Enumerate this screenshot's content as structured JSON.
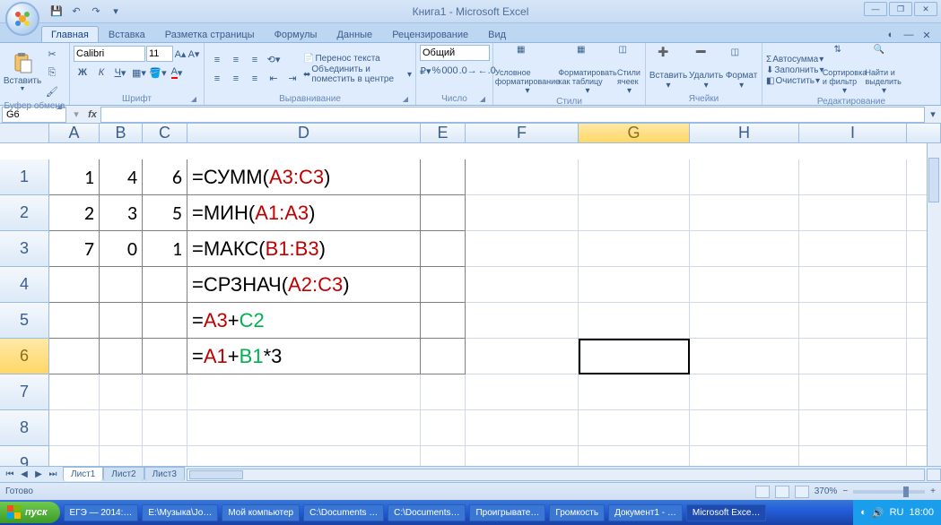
{
  "title": "Книга1 - Microsoft Excel",
  "tabs": [
    "Главная",
    "Вставка",
    "Разметка страницы",
    "Формулы",
    "Данные",
    "Рецензирование",
    "Вид"
  ],
  "active_tab": 0,
  "clipboard": {
    "paste": "Вставить",
    "label": "Буфер обмена"
  },
  "font": {
    "name": "Calibri",
    "size": "11",
    "label": "Шрифт"
  },
  "align": {
    "wrap": "Перенос текста",
    "merge": "Объединить и поместить в центре",
    "label": "Выравнивание"
  },
  "number": {
    "format": "Общий",
    "label": "Число"
  },
  "styles": {
    "cond": "Условное форматирование",
    "table": "Форматировать как таблицу",
    "cell": "Стили ячеек",
    "label": "Стили"
  },
  "cells": {
    "insert": "Вставить",
    "delete": "Удалить",
    "format": "Формат",
    "label": "Ячейки"
  },
  "editing": {
    "sum": "Автосумма",
    "fill": "Заполнить",
    "clear": "Очистить",
    "sort": "Сортировка и фильтр",
    "find": "Найти и выделить",
    "label": "Редактирование"
  },
  "namebox": "G6",
  "formula": "",
  "columns": [
    "A",
    "B",
    "C",
    "D",
    "E",
    "F",
    "G",
    "H",
    "I"
  ],
  "rows": [
    "1",
    "2",
    "3",
    "4",
    "5",
    "6",
    "7",
    "8",
    "9"
  ],
  "selected_cell": {
    "row": 6,
    "col": "G"
  },
  "data": {
    "A1": "1",
    "B1": "4",
    "C1": "6",
    "A2": "2",
    "B2": "3",
    "C2": "5",
    "A3": "7",
    "B3": "0",
    "C3": "1"
  },
  "formulas_display": {
    "D1": [
      {
        "t": "=СУММ(",
        "c": "blk"
      },
      {
        "t": "A3:C3",
        "c": "red"
      },
      {
        "t": ")",
        "c": "blk"
      }
    ],
    "D2": [
      {
        "t": "=МИН(",
        "c": "blk"
      },
      {
        "t": "A1:A3",
        "c": "red"
      },
      {
        "t": ")",
        "c": "blk"
      }
    ],
    "D3": [
      {
        "t": "=МАКС(",
        "c": "blk"
      },
      {
        "t": "B1:B3",
        "c": "red"
      },
      {
        "t": ")",
        "c": "blk"
      }
    ],
    "D4": [
      {
        "t": "=СРЗНАЧ(",
        "c": "blk"
      },
      {
        "t": "A2:C3",
        "c": "red"
      },
      {
        "t": ")",
        "c": "blk"
      }
    ],
    "D5": [
      {
        "t": "=",
        "c": "blk"
      },
      {
        "t": "A3",
        "c": "red"
      },
      {
        "t": "+",
        "c": "blk"
      },
      {
        "t": "C2",
        "c": "grn"
      }
    ],
    "D6": [
      {
        "t": "= ",
        "c": "blk"
      },
      {
        "t": "A1",
        "c": "red"
      },
      {
        "t": "+",
        "c": "blk"
      },
      {
        "t": "B1",
        "c": "grn"
      },
      {
        "t": "*3",
        "c": "blk"
      }
    ]
  },
  "sheets": [
    "Лист1",
    "Лист2",
    "Лист3"
  ],
  "active_sheet": 0,
  "status": "Готово",
  "zoom": "370%",
  "taskbar": {
    "start": "пуск",
    "items": [
      "ЕГЭ — 2014:…",
      "E:\\Музыка\\Jo…",
      "Мой компьютер",
      "C:\\Documents …",
      "C:\\Documents…",
      "Проигрывате…",
      "Громкость",
      "Документ1 - …",
      "Microsoft Exce…"
    ],
    "active_item": 8,
    "time": "18:00",
    "lang": "RU"
  }
}
